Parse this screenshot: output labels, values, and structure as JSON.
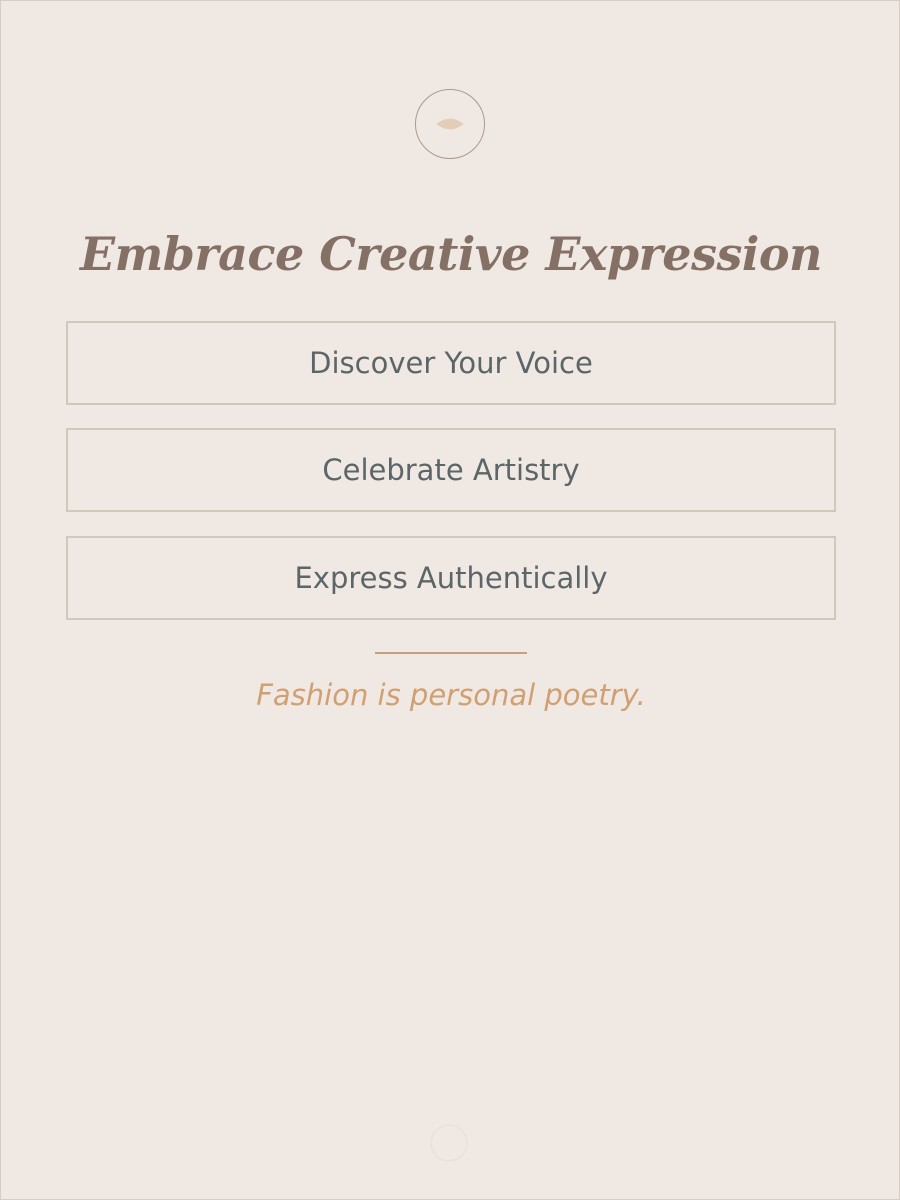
{
  "header": {
    "emblem_icon": "leaf-icon",
    "title": "Embrace Creative Expression"
  },
  "options": [
    {
      "label": "Discover Your Voice"
    },
    {
      "label": "Celebrate Artistry"
    },
    {
      "label": "Express Authentically"
    }
  ],
  "footer": {
    "tagline": "Fashion is personal poetry.",
    "mark_icon": "faint-circle-icon"
  },
  "colors": {
    "background": "#f0e9e3",
    "title": "#857066",
    "button_text": "#5c6669",
    "button_border": "#d0c7be",
    "accent": "#d1a072"
  }
}
